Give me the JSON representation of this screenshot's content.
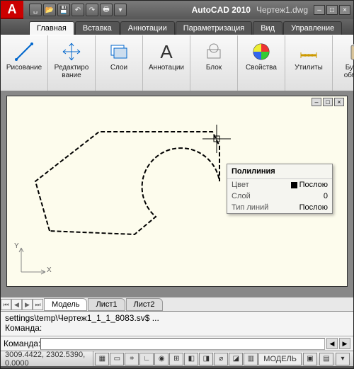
{
  "app": {
    "name": "AutoCAD 2010",
    "document": "Чертеж1.dwg"
  },
  "qat": {
    "new": "␣",
    "open": "📂",
    "save": "💾",
    "undo": "↶",
    "redo": "↷",
    "print": "🖶",
    "more": "▾"
  },
  "window_buttons": {
    "min": "–",
    "max": "□",
    "close": "×"
  },
  "doc_window_buttons": {
    "min": "–",
    "max": "□",
    "close": "×"
  },
  "ribbon_tabs": [
    "Главная",
    "Вставка",
    "Аннотации",
    "Параметризация",
    "Вид",
    "Управление"
  ],
  "ribbon_active": 0,
  "ribbon": {
    "panels": [
      {
        "label": "Рисование",
        "icon": "line-icon"
      },
      {
        "label": "Редактиро\nвание",
        "icon": "move-icon"
      },
      {
        "label": "Слои",
        "icon": "layers-icon"
      },
      {
        "label": "Аннотации",
        "icon": "text-icon"
      },
      {
        "label": "Блок",
        "icon": "block-icon"
      },
      {
        "label": "Свойства",
        "icon": "properties-icon"
      },
      {
        "label": "Утилиты",
        "icon": "measure-icon"
      },
      {
        "label": "Буфер\nобмена",
        "icon": "clipboard-icon"
      }
    ]
  },
  "tooltip": {
    "title": "Полилиния",
    "rows": [
      {
        "k": "Цвет",
        "v": "Послою",
        "swatch": true
      },
      {
        "k": "Слой",
        "v": "0"
      },
      {
        "k": "Тип линий",
        "v": "Послою"
      }
    ]
  },
  "doc_tabs": {
    "nav": [
      "⏮",
      "◀",
      "▶",
      "⏭"
    ],
    "tabs": [
      "Модель",
      "Лист1",
      "Лист2"
    ],
    "active": 0
  },
  "ucs": {
    "x": "X",
    "y": "Y"
  },
  "command": {
    "history": "settings\\temp\\Чертеж1_1_1_8083.sv$ ...\nКоманда:",
    "prompt": "Команда:",
    "value": ""
  },
  "status": {
    "coords": "3009.4422, 2302.5390, 0.0000",
    "model_label": "МОДЕЛЬ",
    "toggles": [
      "▦",
      "▭",
      "⌗",
      "∟",
      "◉",
      "⊞",
      "◧",
      "◨",
      "⌀",
      "◪",
      "▥"
    ]
  }
}
